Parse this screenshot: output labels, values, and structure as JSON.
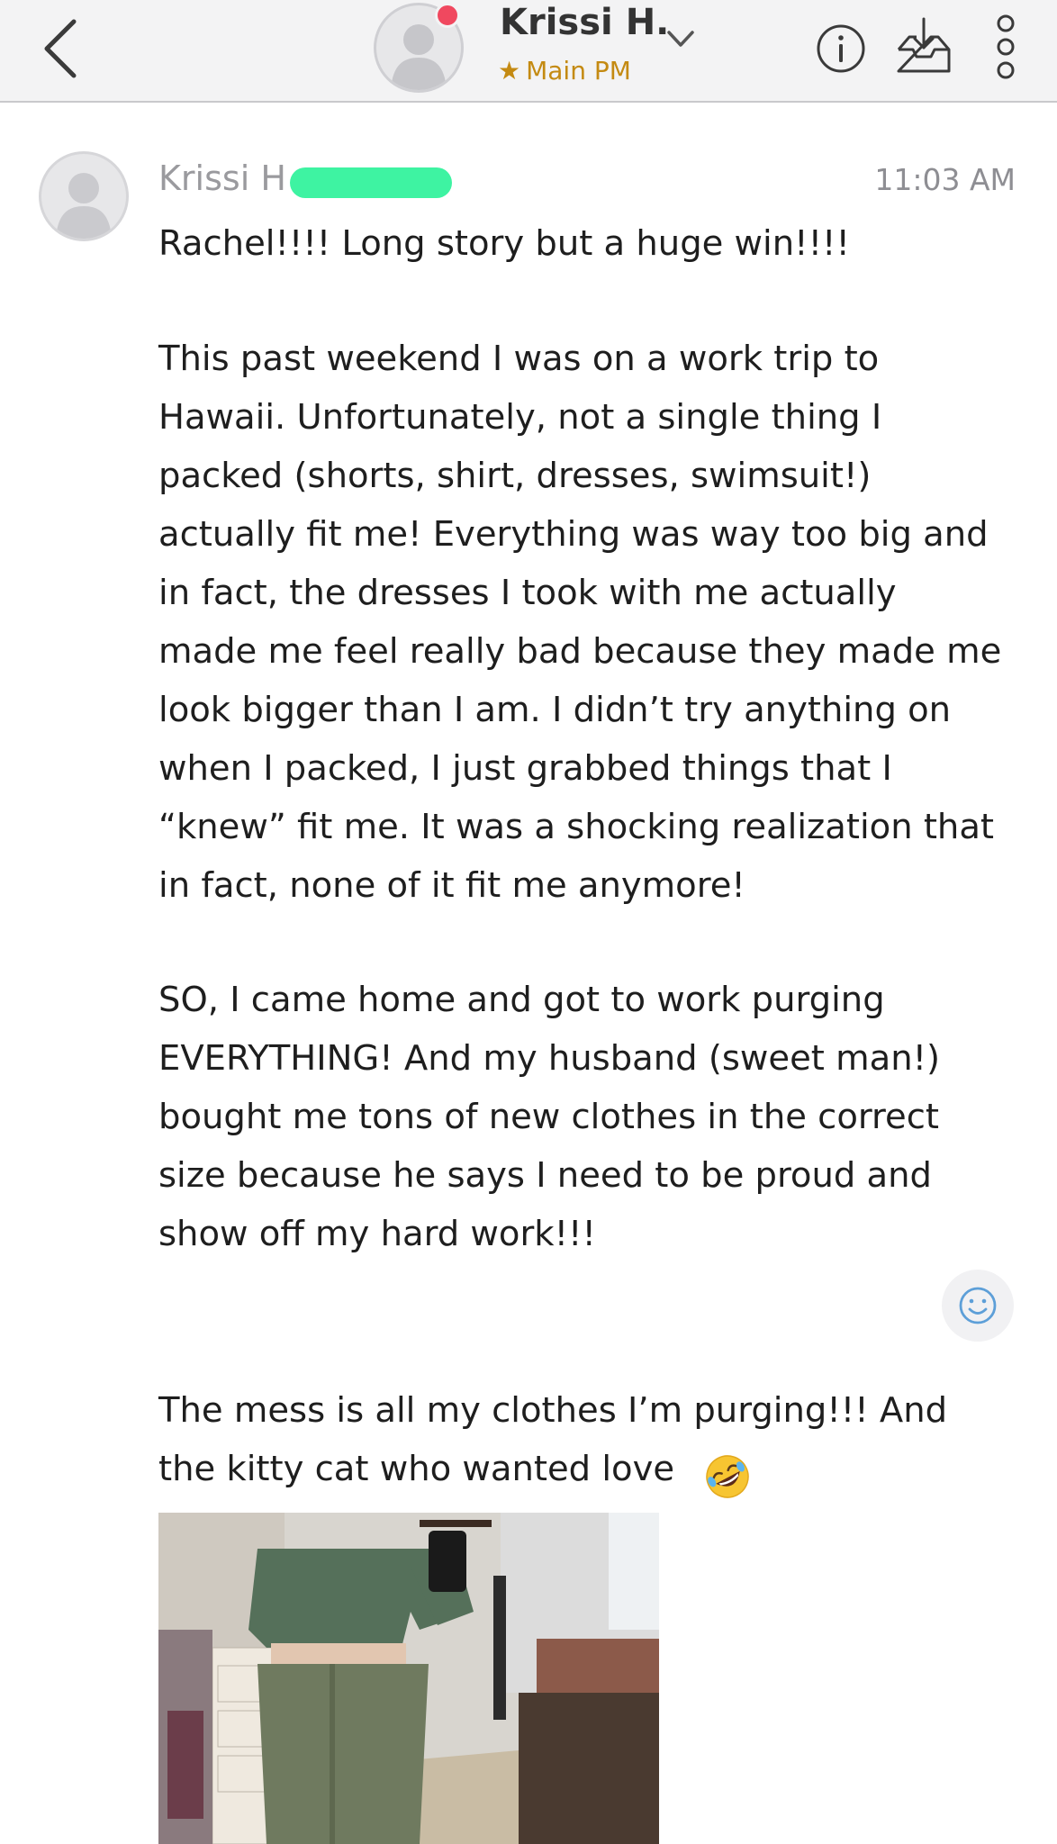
{
  "header": {
    "contact_name": "Krissi H.",
    "folder_label": "Main PM",
    "folder_icon": "star-icon",
    "accent_color": "#c48a12",
    "presence_color": "#f0485f"
  },
  "message": {
    "sender": "Krissi H",
    "timestamp": "11:03 AM",
    "paragraphs": [
      "Rachel!!!! Long story but a huge win!!!!",
      "This past weekend I was on a work trip to\nHawaii. Unfortunately, not a single thing I\npacked (shorts, shirt, dresses, swimsuit!)\nactually fit me! Everything was way too big and\nin fact, the dresses I took with me actually\nmade me feel really bad because they made me\nlook bigger than I am. I didn’t try anything on\nwhen I packed, I just grabbed things that I\n“knew” fit me. It was a shocking realization that\nin fact, none of it fit me anymore!",
      "SO, I came home and got to work purging\nEVERYTHING! And my husband (sweet man!)\nbought me tons of new clothes in the correct\nsize because he says I need to be proud and\nshow off my hard work!!!",
      "The mess is all my clothes I’m purging!!! And\nthe kitty cat who wanted love"
    ],
    "emoji": "rolling-on-floor-laughing-emoji",
    "redaction_color": "#3ef3a2"
  }
}
